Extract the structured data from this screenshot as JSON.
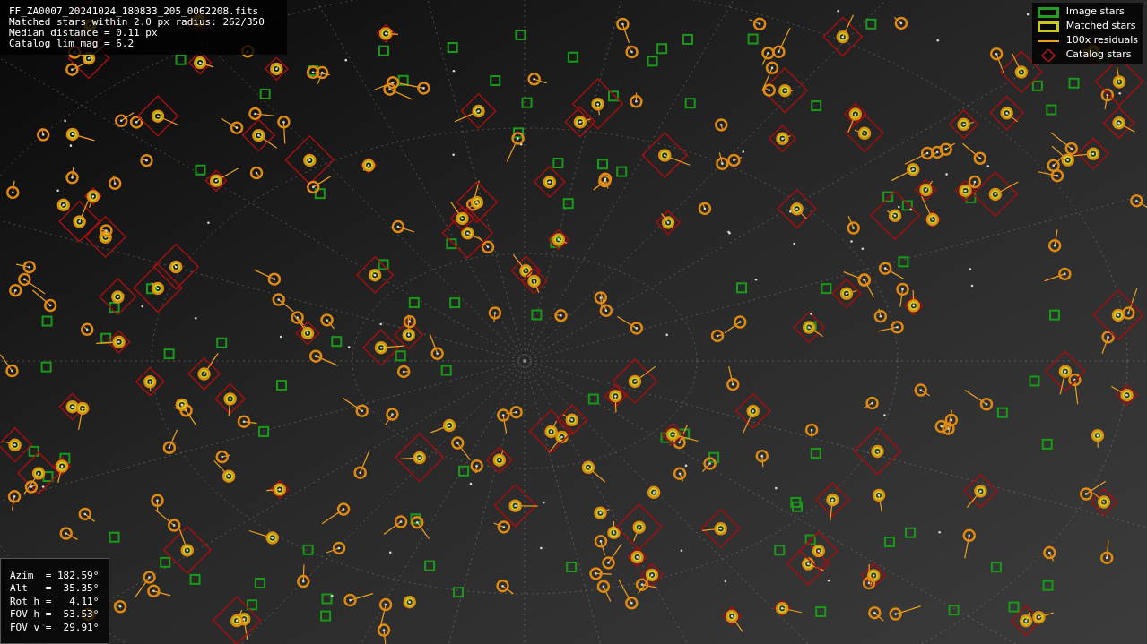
{
  "info_lines": [
    "FF_ZA0007_20241024_180833_205_0062208.fits",
    "Matched stars within 2.0 px radius: 262/350",
    "Median distance = 0.11 px",
    "Catalog lim mag = 6.2"
  ],
  "legend": [
    {
      "kind": "image",
      "label": "Image stars",
      "color": "#1f9e1f"
    },
    {
      "kind": "matched",
      "label": "Matched stars",
      "color": "#c8c81e"
    },
    {
      "kind": "residual",
      "label": "100x residuals",
      "color": "#f0a020"
    },
    {
      "kind": "catalog",
      "label": "Catalog stars",
      "color": "#b01818"
    }
  ],
  "pointing_lines": [
    "Azim  = 182.59°",
    "Alt   =  35.35°",
    "Rot h =   4.11°",
    "FOV h =  53.53°",
    "FOV v =  29.91°"
  ]
}
